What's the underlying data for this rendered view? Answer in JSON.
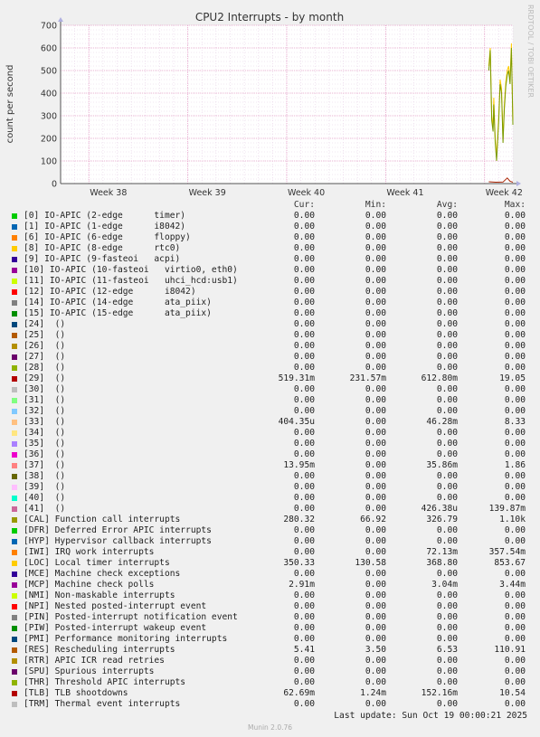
{
  "chart_data": {
    "type": "line",
    "title": "CPU2 Interrupts - by month",
    "ylabel": "count per second",
    "side_label": "RRDTOOL / TOBI OETIKER",
    "ylim": [
      0,
      700
    ],
    "yticks": [
      0,
      100,
      200,
      300,
      400,
      500,
      600,
      700
    ],
    "x_range_days": [
      0,
      32
    ],
    "xticks": [
      {
        "label": "Week 38",
        "day": 2
      },
      {
        "label": "Week 39",
        "day": 9
      },
      {
        "label": "Week 40",
        "day": 16
      },
      {
        "label": "Week 41",
        "day": 23
      },
      {
        "label": "Week 42",
        "day": 30
      }
    ],
    "series": [
      {
        "name": "[LOC] Local timer interrupts",
        "color": "#ffcc00",
        "points": [
          [
            30.3,
            520
          ],
          [
            30.4,
            600
          ],
          [
            30.5,
            300
          ],
          [
            30.6,
            250
          ],
          [
            30.65,
            380
          ],
          [
            30.75,
            200
          ],
          [
            30.85,
            120
          ],
          [
            30.9,
            180
          ],
          [
            31.0,
            300
          ],
          [
            31.1,
            460
          ],
          [
            31.2,
            420
          ],
          [
            31.3,
            200
          ],
          [
            31.4,
            350
          ],
          [
            31.5,
            450
          ],
          [
            31.6,
            500
          ],
          [
            31.7,
            520
          ],
          [
            31.8,
            460
          ],
          [
            31.9,
            620
          ],
          [
            32.0,
            280
          ]
        ]
      },
      {
        "name": "[CAL] Function call interrupts",
        "color": "#7a9a01",
        "points": [
          [
            30.3,
            500
          ],
          [
            30.4,
            590
          ],
          [
            30.5,
            280
          ],
          [
            30.6,
            230
          ],
          [
            30.65,
            350
          ],
          [
            30.75,
            180
          ],
          [
            30.85,
            100
          ],
          [
            30.9,
            160
          ],
          [
            31.0,
            280
          ],
          [
            31.1,
            440
          ],
          [
            31.2,
            400
          ],
          [
            31.3,
            180
          ],
          [
            31.4,
            330
          ],
          [
            31.5,
            430
          ],
          [
            31.6,
            480
          ],
          [
            31.7,
            500
          ],
          [
            31.8,
            440
          ],
          [
            31.9,
            600
          ],
          [
            32.0,
            260
          ]
        ]
      },
      {
        "name": "[RES] Rescheduling interrupts",
        "color": "#aa2200",
        "points": [
          [
            30.3,
            8
          ],
          [
            30.8,
            6
          ],
          [
            31.3,
            7
          ],
          [
            31.6,
            25
          ],
          [
            31.8,
            10
          ],
          [
            32.0,
            6
          ]
        ]
      }
    ]
  },
  "legend": {
    "headers": [
      "Cur:",
      "Min:",
      "Avg:",
      "Max:"
    ],
    "items": [
      {
        "color": "#00cc00",
        "label": "[0] IO-APIC (2-edge      timer)",
        "cur": "0.00",
        "min": "0.00",
        "avg": "0.00",
        "max": "0.00"
      },
      {
        "color": "#0066b3",
        "label": "[1] IO-APIC (1-edge      i8042)",
        "cur": "0.00",
        "min": "0.00",
        "avg": "0.00",
        "max": "0.00"
      },
      {
        "color": "#ff8000",
        "label": "[6] IO-APIC (6-edge      floppy)",
        "cur": "0.00",
        "min": "0.00",
        "avg": "0.00",
        "max": "0.00"
      },
      {
        "color": "#ffcc00",
        "label": "[8] IO-APIC (8-edge      rtc0)",
        "cur": "0.00",
        "min": "0.00",
        "avg": "0.00",
        "max": "0.00"
      },
      {
        "color": "#330099",
        "label": "[9] IO-APIC (9-fasteoi   acpi)",
        "cur": "0.00",
        "min": "0.00",
        "avg": "0.00",
        "max": "0.00"
      },
      {
        "color": "#990099",
        "label": "[10] IO-APIC (10-fasteoi   virtio0, eth0)",
        "cur": "0.00",
        "min": "0.00",
        "avg": "0.00",
        "max": "0.00"
      },
      {
        "color": "#ccff00",
        "label": "[11] IO-APIC (11-fasteoi   uhci_hcd:usb1)",
        "cur": "0.00",
        "min": "0.00",
        "avg": "0.00",
        "max": "0.00"
      },
      {
        "color": "#ff0000",
        "label": "[12] IO-APIC (12-edge      i8042)",
        "cur": "0.00",
        "min": "0.00",
        "avg": "0.00",
        "max": "0.00"
      },
      {
        "color": "#808080",
        "label": "[14] IO-APIC (14-edge      ata_piix)",
        "cur": "0.00",
        "min": "0.00",
        "avg": "0.00",
        "max": "0.00"
      },
      {
        "color": "#008f00",
        "label": "[15] IO-APIC (15-edge      ata_piix)",
        "cur": "0.00",
        "min": "0.00",
        "avg": "0.00",
        "max": "0.00"
      },
      {
        "color": "#00487d",
        "label": "[24]  ()",
        "cur": "0.00",
        "min": "0.00",
        "avg": "0.00",
        "max": "0.00"
      },
      {
        "color": "#b35a00",
        "label": "[25]  ()",
        "cur": "0.00",
        "min": "0.00",
        "avg": "0.00",
        "max": "0.00"
      },
      {
        "color": "#b38f00",
        "label": "[26]  ()",
        "cur": "0.00",
        "min": "0.00",
        "avg": "0.00",
        "max": "0.00"
      },
      {
        "color": "#6b006b",
        "label": "[27]  ()",
        "cur": "0.00",
        "min": "0.00",
        "avg": "0.00",
        "max": "0.00"
      },
      {
        "color": "#8fb300",
        "label": "[28]  ()",
        "cur": "0.00",
        "min": "0.00",
        "avg": "0.00",
        "max": "0.00"
      },
      {
        "color": "#b30000",
        "label": "[29]  ()",
        "cur": "519.31m",
        "min": "231.57m",
        "avg": "612.80m",
        "max": "19.05"
      },
      {
        "color": "#bebebe",
        "label": "[30]  ()",
        "cur": "0.00",
        "min": "0.00",
        "avg": "0.00",
        "max": "0.00"
      },
      {
        "color": "#80ff80",
        "label": "[31]  ()",
        "cur": "0.00",
        "min": "0.00",
        "avg": "0.00",
        "max": "0.00"
      },
      {
        "color": "#80c9ff",
        "label": "[32]  ()",
        "cur": "0.00",
        "min": "0.00",
        "avg": "0.00",
        "max": "0.00"
      },
      {
        "color": "#ffc080",
        "label": "[33]  ()",
        "cur": "404.35u",
        "min": "0.00",
        "avg": "46.28m",
        "max": "8.33"
      },
      {
        "color": "#ffe680",
        "label": "[34]  ()",
        "cur": "0.00",
        "min": "0.00",
        "avg": "0.00",
        "max": "0.00"
      },
      {
        "color": "#aa80ff",
        "label": "[35]  ()",
        "cur": "0.00",
        "min": "0.00",
        "avg": "0.00",
        "max": "0.00"
      },
      {
        "color": "#ee00cc",
        "label": "[36]  ()",
        "cur": "0.00",
        "min": "0.00",
        "avg": "0.00",
        "max": "0.00"
      },
      {
        "color": "#ff8080",
        "label": "[37]  ()",
        "cur": "13.95m",
        "min": "0.00",
        "avg": "35.86m",
        "max": "1.86"
      },
      {
        "color": "#666600",
        "label": "[38]  ()",
        "cur": "0.00",
        "min": "0.00",
        "avg": "0.00",
        "max": "0.00"
      },
      {
        "color": "#ffbfff",
        "label": "[39]  ()",
        "cur": "0.00",
        "min": "0.00",
        "avg": "0.00",
        "max": "0.00"
      },
      {
        "color": "#00ffcc",
        "label": "[40]  ()",
        "cur": "0.00",
        "min": "0.00",
        "avg": "0.00",
        "max": "0.00"
      },
      {
        "color": "#cc6699",
        "label": "[41]  ()",
        "cur": "0.00",
        "min": "0.00",
        "avg": "426.38u",
        "max": "139.87m"
      },
      {
        "color": "#999900",
        "label": "[CAL] Function call interrupts",
        "cur": "280.32",
        "min": "66.92",
        "avg": "326.79",
        "max": "1.10k"
      },
      {
        "color": "#00cc00",
        "label": "[DFR] Deferred Error APIC interrupts",
        "cur": "0.00",
        "min": "0.00",
        "avg": "0.00",
        "max": "0.00"
      },
      {
        "color": "#0066b3",
        "label": "[HYP] Hypervisor callback interrupts",
        "cur": "0.00",
        "min": "0.00",
        "avg": "0.00",
        "max": "0.00"
      },
      {
        "color": "#ff8000",
        "label": "[IWI] IRQ work interrupts",
        "cur": "0.00",
        "min": "0.00",
        "avg": "72.13m",
        "max": "357.54m"
      },
      {
        "color": "#ffcc00",
        "label": "[LOC] Local timer interrupts",
        "cur": "350.33",
        "min": "130.58",
        "avg": "368.80",
        "max": "853.67"
      },
      {
        "color": "#330099",
        "label": "[MCE] Machine check exceptions",
        "cur": "0.00",
        "min": "0.00",
        "avg": "0.00",
        "max": "0.00"
      },
      {
        "color": "#990099",
        "label": "[MCP] Machine check polls",
        "cur": "2.91m",
        "min": "0.00",
        "avg": "3.04m",
        "max": "3.44m"
      },
      {
        "color": "#ccff00",
        "label": "[NMI] Non-maskable interrupts",
        "cur": "0.00",
        "min": "0.00",
        "avg": "0.00",
        "max": "0.00"
      },
      {
        "color": "#ff0000",
        "label": "[NPI] Nested posted-interrupt event",
        "cur": "0.00",
        "min": "0.00",
        "avg": "0.00",
        "max": "0.00"
      },
      {
        "color": "#808080",
        "label": "[PIN] Posted-interrupt notification event",
        "cur": "0.00",
        "min": "0.00",
        "avg": "0.00",
        "max": "0.00"
      },
      {
        "color": "#008f00",
        "label": "[PIW] Posted-interrupt wakeup event",
        "cur": "0.00",
        "min": "0.00",
        "avg": "0.00",
        "max": "0.00"
      },
      {
        "color": "#00487d",
        "label": "[PMI] Performance monitoring interrupts",
        "cur": "0.00",
        "min": "0.00",
        "avg": "0.00",
        "max": "0.00"
      },
      {
        "color": "#b35a00",
        "label": "[RES] Rescheduling interrupts",
        "cur": "5.41",
        "min": "3.50",
        "avg": "6.53",
        "max": "110.91"
      },
      {
        "color": "#b38f00",
        "label": "[RTR] APIC ICR read retries",
        "cur": "0.00",
        "min": "0.00",
        "avg": "0.00",
        "max": "0.00"
      },
      {
        "color": "#6b006b",
        "label": "[SPU] Spurious interrupts",
        "cur": "0.00",
        "min": "0.00",
        "avg": "0.00",
        "max": "0.00"
      },
      {
        "color": "#8fb300",
        "label": "[THR] Threshold APIC interrupts",
        "cur": "0.00",
        "min": "0.00",
        "avg": "0.00",
        "max": "0.00"
      },
      {
        "color": "#b30000",
        "label": "[TLB] TLB shootdowns",
        "cur": "62.69m",
        "min": "1.24m",
        "avg": "152.16m",
        "max": "10.54"
      },
      {
        "color": "#bebebe",
        "label": "[TRM] Thermal event interrupts",
        "cur": "0.00",
        "min": "0.00",
        "avg": "0.00",
        "max": "0.00"
      }
    ]
  },
  "last_update": "Last update: Sun Oct 19 00:00:21 2025",
  "footer": "Munin 2.0.76"
}
